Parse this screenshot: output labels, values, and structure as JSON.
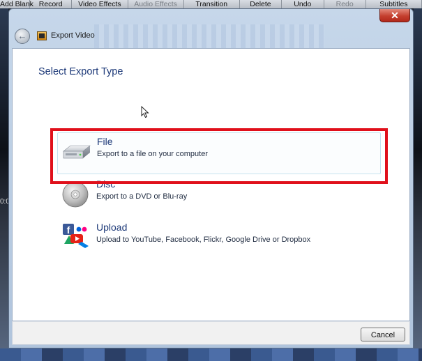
{
  "app_toolbar": {
    "items": [
      {
        "label": "Add Blank",
        "enabled": true
      },
      {
        "label": "Record",
        "enabled": true
      },
      {
        "label": "Video Effects",
        "enabled": true
      },
      {
        "label": "Audio Effects",
        "enabled": false
      },
      {
        "label": "Transition",
        "enabled": true
      },
      {
        "label": "Delete",
        "enabled": true
      },
      {
        "label": "Undo",
        "enabled": true
      },
      {
        "label": "Redo",
        "enabled": false
      },
      {
        "label": "Subtitles",
        "enabled": true
      }
    ]
  },
  "background": {
    "timecode": "0:0"
  },
  "window": {
    "title": "Export Video",
    "close_label": "✕"
  },
  "dialog": {
    "heading": "Select Export Type",
    "options": [
      {
        "label": "File",
        "description": "Export to a file on your computer",
        "icon": "hard-drive-icon",
        "highlighted": true
      },
      {
        "label": "Disc",
        "description": "Export to a DVD or Blu-ray",
        "icon": "disc-icon",
        "highlighted": false
      },
      {
        "label": "Upload",
        "description": "Upload to YouTube, Facebook, Flickr, Google Drive or Dropbox",
        "icon": "upload-services-icon",
        "highlighted": false
      }
    ],
    "cancel_label": "Cancel"
  },
  "colors": {
    "highlight_border": "#e0101b",
    "heading_text": "#1e3a79",
    "close_button": "#c4402f"
  }
}
